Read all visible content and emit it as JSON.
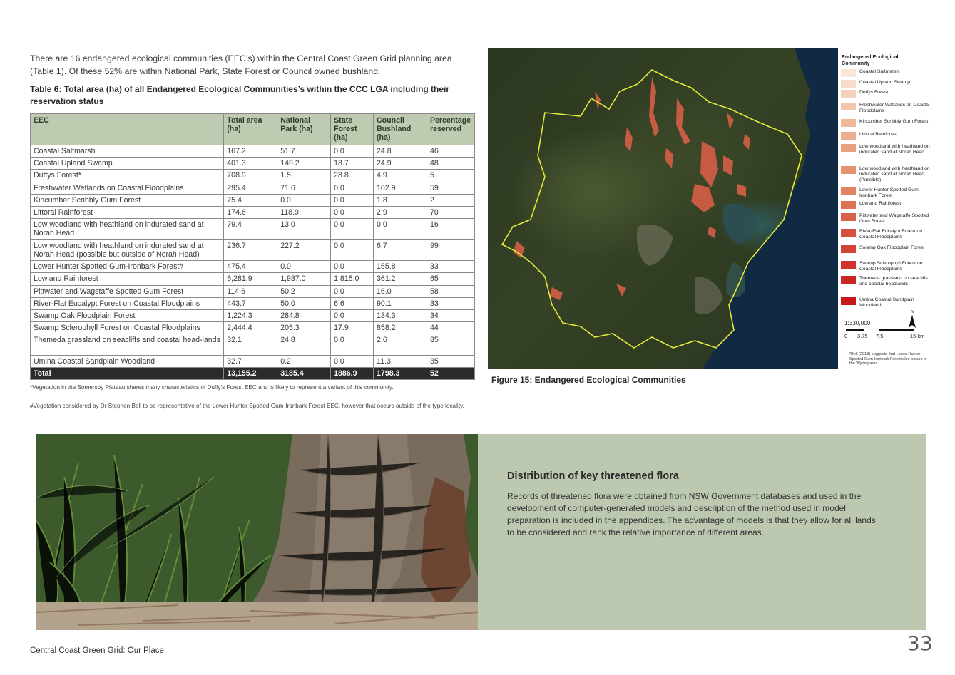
{
  "intro": "There are 16 endangered ecological communities (EEC’s) within the Central Coast Green Grid planning area (Table 1). Of these 52% are within National Park, State Forest or Council owned bushland.",
  "table_caption": "Table 6: Total area (ha) of all Endangered Ecological Communities’s within the CCC LGA including their reservation status",
  "table": {
    "headers": [
      "EEC",
      "Total area (ha)",
      "National Park (ha)",
      "State Forest (ha)",
      "Council Bushland (ha)",
      "Percentage reserved"
    ],
    "rows": [
      [
        "Coastal Saltmarsh",
        "167.2",
        "51.7",
        "0.0",
        "24.8",
        "46"
      ],
      [
        "Coastal Upland Swamp",
        "401.3",
        "149.2",
        "18.7",
        "24.9",
        "48"
      ],
      [
        "Duffys Forest*",
        "708.9",
        "1.5",
        "28.8",
        "4.9",
        "5"
      ],
      [
        "Freshwater Wetlands on Coastal Floodplains",
        "295.4",
        "71.6",
        "0.0",
        "102.9",
        "59"
      ],
      [
        "Kincumber Scribbly Gum Forest",
        "75.4",
        "0.0",
        "0.0",
        "1.8",
        "2"
      ],
      [
        "Littoral Rainforest",
        "174.6",
        "118.9",
        "0.0",
        "2.9",
        "70"
      ],
      [
        "Low woodland with heathland on indurated sand at Norah Head",
        "79.4",
        "13.0",
        "0.0",
        "0.0",
        "16"
      ],
      [
        "Low woodland with heathland on indurated sand at Norah Head (possible but outside of Norah Head)",
        "236.7",
        "227.2",
        "0.0",
        "6.7",
        "99"
      ],
      [
        "Lower Hunter Spotted Gum-Ironbark Forest#",
        "475.4",
        "0.0",
        "0.0",
        "155.8",
        "33"
      ],
      [
        "Lowland Rainforest",
        "6,281.9",
        "1,937.0",
        "1,815.0",
        "361.2",
        "65"
      ],
      [
        "Pittwater and Wagstaffe Spotted Gum Forest",
        "114.6",
        "50.2",
        "0.0",
        "16.0",
        "58"
      ],
      [
        "River-Flat Eucalypt Forest on Coastal Floodplains",
        "443.7",
        "50.0",
        "6.6",
        "90.1",
        "33"
      ],
      [
        "Swamp Oak Floodplain Forest",
        "1,224.3",
        "284.8",
        "0.0",
        "134.3",
        "34"
      ],
      [
        "Swamp Sclerophyll Forest on Coastal Floodplains",
        "2,444.4",
        "205.3",
        "17.9",
        "858.2",
        "44"
      ],
      [
        "Themeda grassland on seacliffs and coastal head-lands",
        "32.1",
        "24.8",
        "0.0",
        "2.6",
        "85"
      ],
      [
        "Umina Coastal Sandplain Woodland",
        "32.7",
        "0.2",
        "0.0",
        "11.3",
        "35"
      ]
    ],
    "total": [
      "Total",
      "13,155.2",
      "3185.4",
      "1886.9",
      "1798.3",
      "52"
    ]
  },
  "note1": "*Vegetation in the Somersby Plateau shares many characteristics of Duffy’s Forest EEC and is likely to represent a variant of this community.",
  "note2": "#Vegetation considered by Dr Stephen Bell to be representative of the Lower Hunter Spotted Gum-Ironbark Forest EEC, however that occurs outside of the type locality.",
  "legend": {
    "title": "Endangered Ecological Community",
    "items": [
      {
        "label": "Coastal Saltmarsh",
        "color": "#fbe7da"
      },
      {
        "label": "Coastal Upland Swamp",
        "color": "#f8dccb"
      },
      {
        "label": "Duffys Forest",
        "color": "#f5d0bc"
      },
      {
        "label": "Freshwater Wetlands on Coastal Floodplains",
        "color": "#f2c5ac"
      },
      {
        "label": "Kincumber Scribbly Gum Forest",
        "color": "#efb99c"
      },
      {
        "label": "Littoral Rainforest",
        "color": "#ecad8c"
      },
      {
        "label": "Low woodland with heathland on indurated sand at Norah Head",
        "color": "#e9a07d"
      },
      {
        "label": "Low woodland with heathland on indurated sand at Norah Head (Possible)",
        "color": "#e6926f"
      },
      {
        "label": "Lower Hunter Spotted Gum-Ironbark Forest",
        "color": "#e28261"
      },
      {
        "label": "Lowland Rainforest",
        "color": "#de7255"
      },
      {
        "label": "Pittwater and Wagstaffe Spotted Gum Forest",
        "color": "#da624a"
      },
      {
        "label": "River-Flat Eucalypt Forest on Coastal Floodplains",
        "color": "#d65240"
      },
      {
        "label": "Swamp Oak Floodplain Forest",
        "color": "#d24236"
      },
      {
        "label": "Swamp Sclerophyll Forest on Coastal Floodplains",
        "color": "#ce342d"
      },
      {
        "label": "Themeda grassland on seacliffs and coastal headlands",
        "color": "#ca2626"
      },
      {
        "label": "Umina Coastal Sandplain Woodland",
        "color": "#c8171d"
      }
    ],
    "scale_ratio": "1:330,000",
    "scale_ticks": [
      "0",
      "3.75",
      "7.5",
      "15 km"
    ],
    "north": "N",
    "note": "*Bell (2013) suggests that Lower Hunter Spotted Gum-Ironbark Forest also occurs in the Wyong area."
  },
  "figure_caption": "Figure 15: Endangered Ecological Communities",
  "section": {
    "heading": "Distribution of key threatened flora",
    "body": "Records of threatened flora were obtained from NSW Government databases and used in the development of computer-generated models and description of the method used in model preparation is included in the appendices. The advantage of models is that they allow for all lands to be considered and rank the relative importance of different areas."
  },
  "footer": "Central Coast Green Grid: Our Place",
  "page_number": "33"
}
